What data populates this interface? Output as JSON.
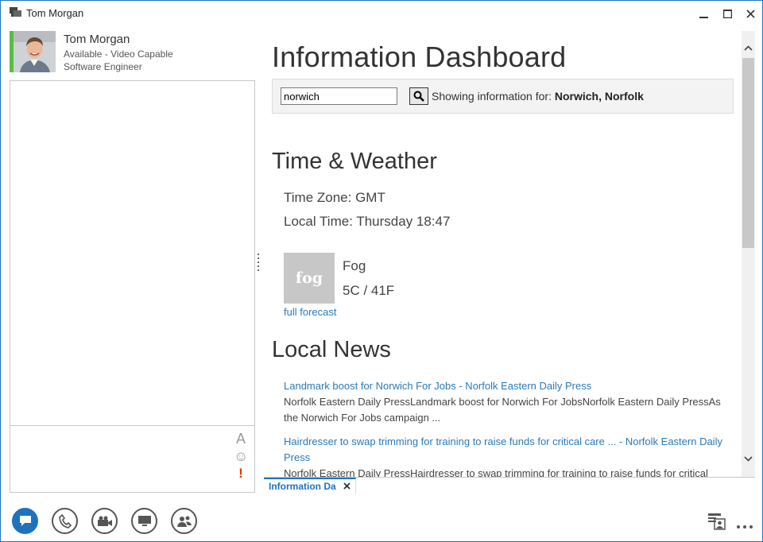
{
  "window": {
    "title": "Tom Morgan",
    "controls": {
      "minimize": "—",
      "maximize": "□",
      "close": "✕"
    }
  },
  "contact": {
    "name": "Tom Morgan",
    "status": "Available - Video Capable",
    "job_title": "Software Engineer",
    "presence_color": "#5dbb46"
  },
  "compose": {
    "font_icon": "A",
    "emoticon_icon": "☺",
    "priority_icon": "!"
  },
  "dashboard": {
    "title": "Information Dashboard",
    "search": {
      "value": "norwich",
      "placeholder": ""
    },
    "showing_prefix": "Showing information for:",
    "showing_location": "Norwich, Norfolk",
    "time_weather": {
      "heading": "Time & Weather",
      "time_zone": "Time Zone: GMT",
      "local_time": "Local Time: Thursday 18:47",
      "weather_image_text": "fog",
      "condition": "Fog",
      "temperature": "5C / 41F",
      "forecast_link": "full forecast"
    },
    "local_news": {
      "heading": "Local News",
      "items": [
        {
          "title": "Landmark boost for Norwich For Jobs - Norfolk Eastern Daily Press",
          "description": "Norfolk Eastern Daily PressLandmark boost for Norwich For JobsNorfolk Eastern Daily PressAs the Norwich For Jobs campaign ..."
        },
        {
          "title": "Hairdresser to swap trimming for training to raise funds for critical care ... - Norfolk Eastern Daily Press",
          "description": "Norfolk Eastern Daily PressHairdresser to swap trimming for training to raise funds for critical"
        }
      ]
    }
  },
  "tabs": [
    {
      "label": "Information Da",
      "close": "✕"
    }
  ],
  "colors": {
    "accent": "#1e73be",
    "link": "#2a7ab8",
    "priority": "#d83b01"
  }
}
